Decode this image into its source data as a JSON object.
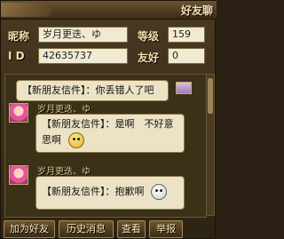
{
  "window": {
    "title": "好友聊"
  },
  "info": {
    "nickname_label": "昵称",
    "nickname_value": "岁月更迭、ゆ",
    "level_label": "等级",
    "level_value": "159",
    "id_label": "I D",
    "id_value": "42635737",
    "friendship_label": "友好",
    "friendship_value": "0"
  },
  "messages": [
    {
      "sender": "",
      "text_line1": "【新朋友信件】：你丢错人了吧",
      "text_line2": ""
    },
    {
      "sender": "岁月更迭、ゆ",
      "text_line1": "【新朋友信件】：是啊　不好意",
      "text_line2": "思啊"
    },
    {
      "sender": "岁月更迭、ゆ",
      "text_line1": "【新朋友信件】：抱歉啊",
      "text_line2": ""
    }
  ],
  "buttons": {
    "add_friend": "加为好友",
    "history": "历史消息",
    "view": "查看",
    "report": "举报"
  }
}
